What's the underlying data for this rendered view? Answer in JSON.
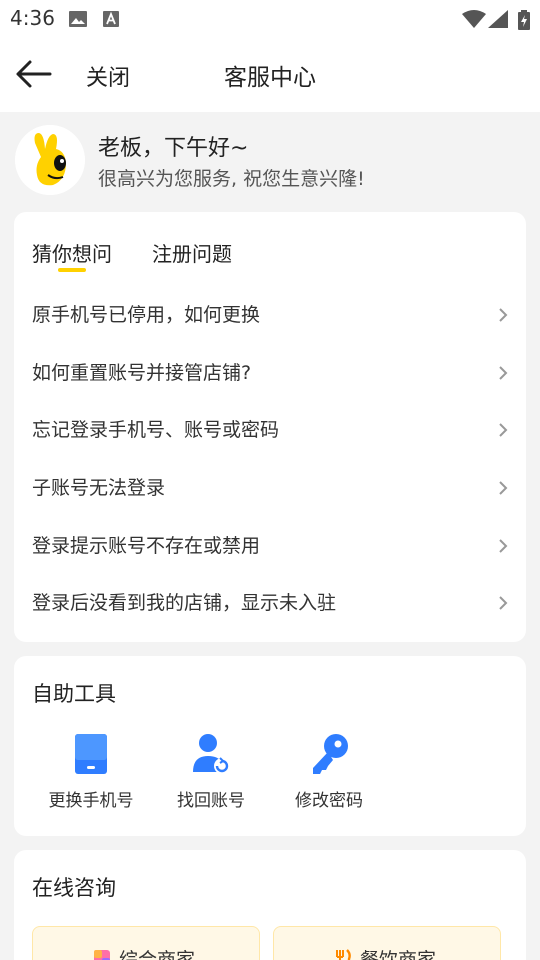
{
  "status_bar": {
    "time": "4:36",
    "icons": [
      "image-icon",
      "font-icon",
      "wifi-icon",
      "signal-icon",
      "battery-icon"
    ]
  },
  "header": {
    "close_label": "关闭",
    "title": "客服中心"
  },
  "greeting": {
    "title": "老板，下午好~",
    "subtitle": "很高兴为您服务, 祝您生意兴隆!"
  },
  "faq": {
    "tabs": [
      {
        "label": "猜你想问",
        "active": true
      },
      {
        "label": "注册问题",
        "active": false
      }
    ],
    "items": [
      "原手机号已停用，如何更换",
      "如何重置账号并接管店铺?",
      "忘记登录手机号、账号或密码",
      "子账号无法登录",
      "登录提示账号不存在或禁用",
      "登录后没看到我的店铺，显示未入驻"
    ]
  },
  "tools": {
    "title": "自助工具",
    "items": [
      {
        "label": "更换手机号",
        "icon": "phone-icon"
      },
      {
        "label": "找回账号",
        "icon": "user-refresh-icon"
      },
      {
        "label": "修改密码",
        "icon": "key-icon"
      }
    ]
  },
  "consult": {
    "title": "在线咨询",
    "buttons": [
      {
        "label": "综合商家",
        "icon": "shop-icon"
      },
      {
        "label": "餐饮商家",
        "icon": "fork-knife-icon"
      }
    ]
  },
  "colors": {
    "accent": "#ffd100",
    "icon_blue": "#2f7dff",
    "background": "#f3f3f3"
  }
}
